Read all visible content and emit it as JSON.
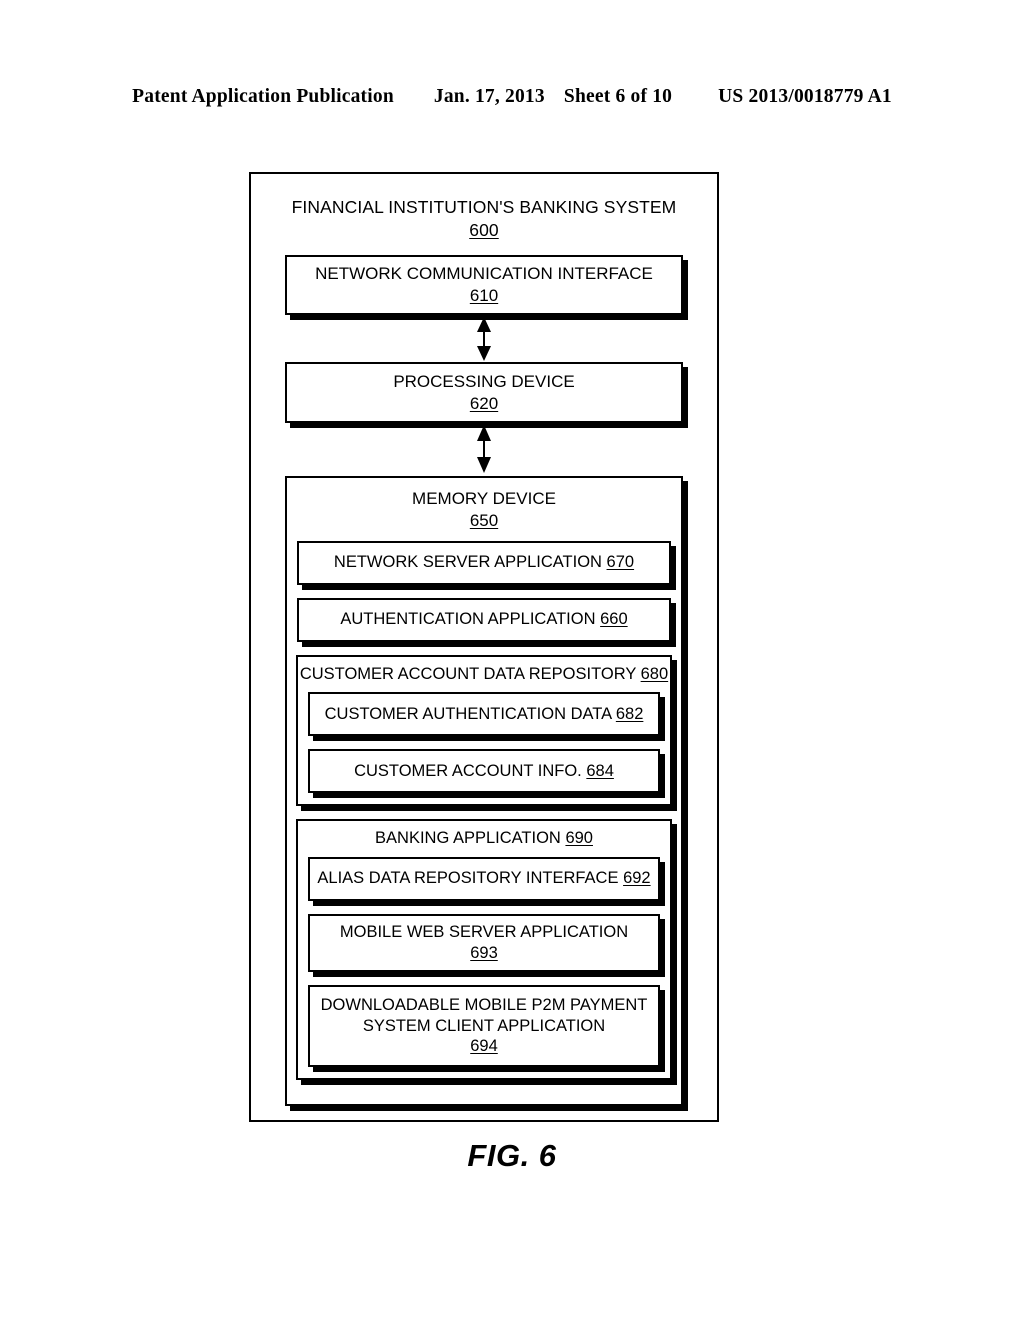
{
  "header": {
    "publication": "Patent Application Publication",
    "date": "Jan. 17, 2013",
    "sheet": "Sheet 6 of 10",
    "patent_number": "US 2013/0018779 A1"
  },
  "figure": {
    "caption": "FIG. 6",
    "system": {
      "title": "FINANCIAL INSTITUTION'S BANKING SYSTEM",
      "ref": "600"
    },
    "network_interface": {
      "title": "NETWORK COMMUNICATION INTERFACE",
      "ref": "610"
    },
    "processing_device": {
      "title": "PROCESSING DEVICE",
      "ref": "620"
    },
    "memory_device": {
      "title": "MEMORY DEVICE",
      "ref": "650"
    },
    "network_server_application": {
      "title": "NETWORK SERVER APPLICATION",
      "ref": "670"
    },
    "authentication_application": {
      "title": "AUTHENTICATION APPLICATION",
      "ref": "660"
    },
    "customer_account_data_repository": {
      "title": "CUSTOMER ACCOUNT DATA REPOSITORY",
      "ref": "680"
    },
    "customer_authentication_data": {
      "title": "CUSTOMER AUTHENTICATION DATA",
      "ref": "682"
    },
    "customer_account_info": {
      "title": "CUSTOMER ACCOUNT INFO.",
      "ref": "684"
    },
    "banking_application": {
      "title": "BANKING APPLICATION",
      "ref": "690"
    },
    "alias_data_repository_interface": {
      "title": "ALIAS DATA REPOSITORY INTERFACE ",
      "ref": "692"
    },
    "mobile_web_server_application": {
      "title": "MOBILE WEB SERVER APPLICATION",
      "ref": "693"
    },
    "downloadable_client_application": {
      "line1": "DOWNLOADABLE MOBILE P2M PAYMENT",
      "line2": "SYSTEM CLIENT APPLICATION",
      "ref": "694"
    },
    "arrows": {
      "interface_to_processor": "double-headed-vertical-arrow",
      "processor_to_memory": "double-headed-vertical-arrow"
    }
  }
}
